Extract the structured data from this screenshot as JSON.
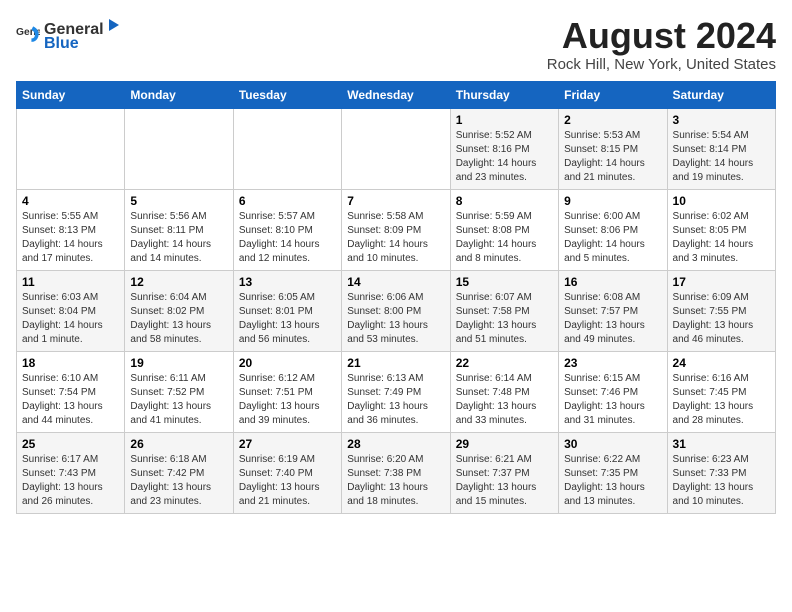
{
  "header": {
    "logo_general": "General",
    "logo_blue": "Blue",
    "title": "August 2024",
    "subtitle": "Rock Hill, New York, United States"
  },
  "days_of_week": [
    "Sunday",
    "Monday",
    "Tuesday",
    "Wednesday",
    "Thursday",
    "Friday",
    "Saturday"
  ],
  "weeks": [
    [
      {
        "day": "",
        "info": ""
      },
      {
        "day": "",
        "info": ""
      },
      {
        "day": "",
        "info": ""
      },
      {
        "day": "",
        "info": ""
      },
      {
        "day": "1",
        "info": "Sunrise: 5:52 AM\nSunset: 8:16 PM\nDaylight: 14 hours\nand 23 minutes."
      },
      {
        "day": "2",
        "info": "Sunrise: 5:53 AM\nSunset: 8:15 PM\nDaylight: 14 hours\nand 21 minutes."
      },
      {
        "day": "3",
        "info": "Sunrise: 5:54 AM\nSunset: 8:14 PM\nDaylight: 14 hours\nand 19 minutes."
      }
    ],
    [
      {
        "day": "4",
        "info": "Sunrise: 5:55 AM\nSunset: 8:13 PM\nDaylight: 14 hours\nand 17 minutes."
      },
      {
        "day": "5",
        "info": "Sunrise: 5:56 AM\nSunset: 8:11 PM\nDaylight: 14 hours\nand 14 minutes."
      },
      {
        "day": "6",
        "info": "Sunrise: 5:57 AM\nSunset: 8:10 PM\nDaylight: 14 hours\nand 12 minutes."
      },
      {
        "day": "7",
        "info": "Sunrise: 5:58 AM\nSunset: 8:09 PM\nDaylight: 14 hours\nand 10 minutes."
      },
      {
        "day": "8",
        "info": "Sunrise: 5:59 AM\nSunset: 8:08 PM\nDaylight: 14 hours\nand 8 minutes."
      },
      {
        "day": "9",
        "info": "Sunrise: 6:00 AM\nSunset: 8:06 PM\nDaylight: 14 hours\nand 5 minutes."
      },
      {
        "day": "10",
        "info": "Sunrise: 6:02 AM\nSunset: 8:05 PM\nDaylight: 14 hours\nand 3 minutes."
      }
    ],
    [
      {
        "day": "11",
        "info": "Sunrise: 6:03 AM\nSunset: 8:04 PM\nDaylight: 14 hours\nand 1 minute."
      },
      {
        "day": "12",
        "info": "Sunrise: 6:04 AM\nSunset: 8:02 PM\nDaylight: 13 hours\nand 58 minutes."
      },
      {
        "day": "13",
        "info": "Sunrise: 6:05 AM\nSunset: 8:01 PM\nDaylight: 13 hours\nand 56 minutes."
      },
      {
        "day": "14",
        "info": "Sunrise: 6:06 AM\nSunset: 8:00 PM\nDaylight: 13 hours\nand 53 minutes."
      },
      {
        "day": "15",
        "info": "Sunrise: 6:07 AM\nSunset: 7:58 PM\nDaylight: 13 hours\nand 51 minutes."
      },
      {
        "day": "16",
        "info": "Sunrise: 6:08 AM\nSunset: 7:57 PM\nDaylight: 13 hours\nand 49 minutes."
      },
      {
        "day": "17",
        "info": "Sunrise: 6:09 AM\nSunset: 7:55 PM\nDaylight: 13 hours\nand 46 minutes."
      }
    ],
    [
      {
        "day": "18",
        "info": "Sunrise: 6:10 AM\nSunset: 7:54 PM\nDaylight: 13 hours\nand 44 minutes."
      },
      {
        "day": "19",
        "info": "Sunrise: 6:11 AM\nSunset: 7:52 PM\nDaylight: 13 hours\nand 41 minutes."
      },
      {
        "day": "20",
        "info": "Sunrise: 6:12 AM\nSunset: 7:51 PM\nDaylight: 13 hours\nand 39 minutes."
      },
      {
        "day": "21",
        "info": "Sunrise: 6:13 AM\nSunset: 7:49 PM\nDaylight: 13 hours\nand 36 minutes."
      },
      {
        "day": "22",
        "info": "Sunrise: 6:14 AM\nSunset: 7:48 PM\nDaylight: 13 hours\nand 33 minutes."
      },
      {
        "day": "23",
        "info": "Sunrise: 6:15 AM\nSunset: 7:46 PM\nDaylight: 13 hours\nand 31 minutes."
      },
      {
        "day": "24",
        "info": "Sunrise: 6:16 AM\nSunset: 7:45 PM\nDaylight: 13 hours\nand 28 minutes."
      }
    ],
    [
      {
        "day": "25",
        "info": "Sunrise: 6:17 AM\nSunset: 7:43 PM\nDaylight: 13 hours\nand 26 minutes."
      },
      {
        "day": "26",
        "info": "Sunrise: 6:18 AM\nSunset: 7:42 PM\nDaylight: 13 hours\nand 23 minutes."
      },
      {
        "day": "27",
        "info": "Sunrise: 6:19 AM\nSunset: 7:40 PM\nDaylight: 13 hours\nand 21 minutes."
      },
      {
        "day": "28",
        "info": "Sunrise: 6:20 AM\nSunset: 7:38 PM\nDaylight: 13 hours\nand 18 minutes."
      },
      {
        "day": "29",
        "info": "Sunrise: 6:21 AM\nSunset: 7:37 PM\nDaylight: 13 hours\nand 15 minutes."
      },
      {
        "day": "30",
        "info": "Sunrise: 6:22 AM\nSunset: 7:35 PM\nDaylight: 13 hours\nand 13 minutes."
      },
      {
        "day": "31",
        "info": "Sunrise: 6:23 AM\nSunset: 7:33 PM\nDaylight: 13 hours\nand 10 minutes."
      }
    ]
  ]
}
